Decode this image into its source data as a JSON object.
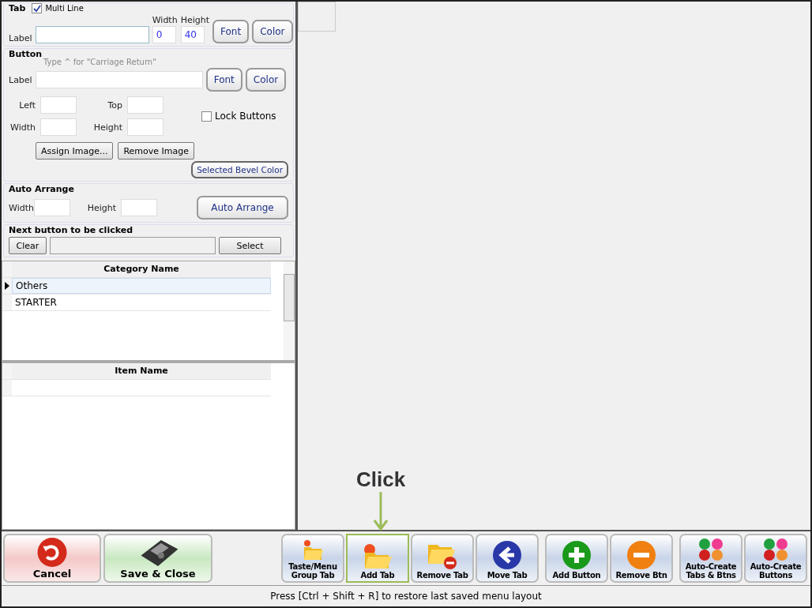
{
  "tab_section": {
    "title": "Tab",
    "multi_line": {
      "label": "Multi Line",
      "checked": true
    },
    "label_caption": "Label",
    "width_caption": "Width",
    "height_caption": "Height",
    "width_value": "0",
    "height_value": "40",
    "buttons": [
      "Font",
      "Color"
    ]
  },
  "button_section": {
    "title": "Button",
    "hint": "Type ^ for \"Carriage Return\"",
    "label_caption": "Label",
    "buttons": [
      "Font",
      "Color"
    ],
    "left_caption": "Left",
    "top_caption": "Top",
    "width_caption": "Width",
    "height_caption": "Height",
    "lock_buttons": {
      "label": "Lock Buttons",
      "checked": false
    },
    "image_buttons": [
      "Assign Image...",
      "Remove Image"
    ],
    "bevel_button": "Selected Bevel Color"
  },
  "auto_arrange": {
    "title": "Auto Arrange",
    "width_caption": "Width",
    "height_caption": "Height",
    "button": "Auto Arrange"
  },
  "next_button": {
    "title": "Next button to be clicked",
    "clear": "Clear",
    "select": "Select"
  },
  "category_table": {
    "column": "Category Name",
    "rows": [
      {
        "name": "Others",
        "selected": true
      },
      {
        "name": "STARTER",
        "selected": false
      }
    ]
  },
  "item_table": {
    "column": "Item Name"
  },
  "toolbar": {
    "left": [
      {
        "label": "Cancel",
        "kind": "cancel"
      },
      {
        "label": "Save & Close",
        "kind": "save"
      }
    ],
    "right": [
      {
        "label": "Taste/Menu Group Tab",
        "kind": "folder-small",
        "highlighted": false
      },
      {
        "label": "Add Tab",
        "kind": "folder-add",
        "highlighted": true
      },
      {
        "label": "Remove Tab",
        "kind": "folder-remove",
        "highlighted": false
      },
      {
        "label": "Move Tab",
        "kind": "move",
        "highlighted": false
      },
      {
        "label": "Add Button",
        "kind": "plus",
        "highlighted": false
      },
      {
        "label": "Remove Btn",
        "kind": "minus",
        "highlighted": false
      },
      {
        "label": "Auto-Create Tabs & Btns",
        "kind": "cluster",
        "highlighted": false
      },
      {
        "label": "Auto-Create Buttons",
        "kind": "cluster",
        "highlighted": false
      }
    ]
  },
  "annotation": {
    "text": "Click"
  },
  "status_bar": "Press [Ctrl + Shift + R] to restore last saved menu layout"
}
